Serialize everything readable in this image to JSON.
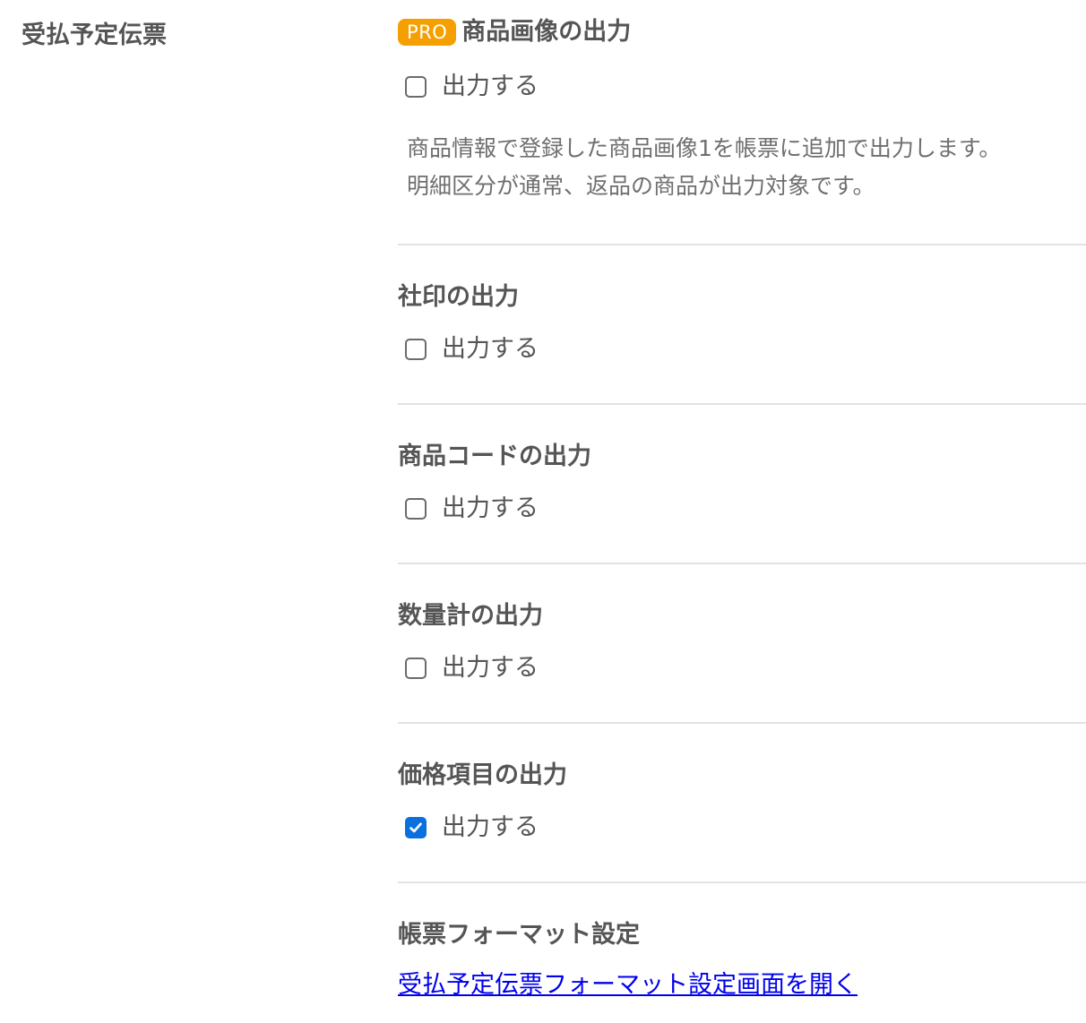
{
  "section": {
    "label": "受払予定伝票"
  },
  "settings": {
    "product_image": {
      "badge": "PRO",
      "title": "商品画像の出力",
      "checkbox_label": "出力する",
      "checked": false,
      "description_line1": "商品情報で登録した商品画像1を帳票に追加で出力します。",
      "description_line2": "明細区分が通常、返品の商品が出力対象です。"
    },
    "company_seal": {
      "title": "社印の出力",
      "checkbox_label": "出力する",
      "checked": false
    },
    "product_code": {
      "title": "商品コードの出力",
      "checkbox_label": "出力する",
      "checked": false
    },
    "quantity_total": {
      "title": "数量計の出力",
      "checkbox_label": "出力する",
      "checked": false
    },
    "price_items": {
      "title": "価格項目の出力",
      "checkbox_label": "出力する",
      "checked": true
    },
    "format": {
      "title": "帳票フォーマット設定",
      "link_text": "受払予定伝票フォーマット設定画面を開く"
    }
  },
  "colors": {
    "pro_badge": "#f5a000",
    "checkbox_checked": "#0b6fde",
    "link": "#0000ee",
    "divider": "#e2e2e2"
  }
}
